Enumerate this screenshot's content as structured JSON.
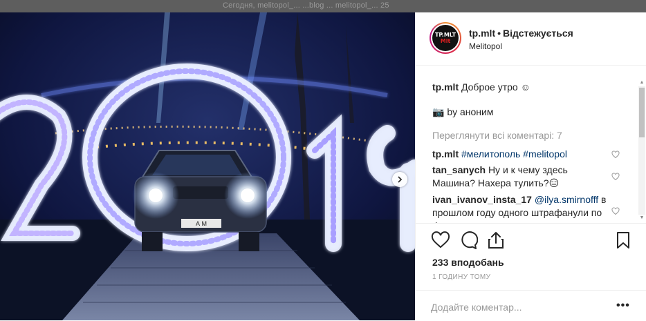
{
  "backdrop": {
    "text": "Сегодня, melitopol_... ...blog ... melitopol_... 25"
  },
  "photo": {
    "alt_text": "",
    "plate_text": "А М"
  },
  "post": {
    "username": "tp.mlt",
    "separator": "•",
    "follow_status": "Відстежується",
    "location": "Melitopol",
    "avatar_text_line1": "TP.MLT",
    "avatar_text_line2": "Mlt"
  },
  "caption": {
    "user": "tp.mlt",
    "text": "Доброе утро ☺",
    "credit": "📷 by аноним"
  },
  "view_all_comments": "Переглянути всі коментарі: 7",
  "comments": [
    {
      "user": "tp.mlt",
      "text": "#мелитополь #melitopol"
    },
    {
      "user": "tan_sanych",
      "text": "Ну и к чему здесь Машина? Нахера тулить?😑"
    },
    {
      "user": "ivan_ivanov_insta_17",
      "mention": "@ilya.smirnofff",
      "text": "в прошлом году одного штрафанули по фото"
    }
  ],
  "likes": "233 вподобань",
  "time_ago": "1 годину тому",
  "add_comment": {
    "placeholder": "Додайте коментар...",
    "more": "•••"
  },
  "icons": {
    "like": "heart-icon",
    "comment": "comment-icon",
    "share": "share-icon",
    "save": "bookmark-icon",
    "next": "chevron-right-icon"
  },
  "colors": {
    "link": "#003569",
    "muted": "#999999",
    "accent": "#3897f0"
  }
}
